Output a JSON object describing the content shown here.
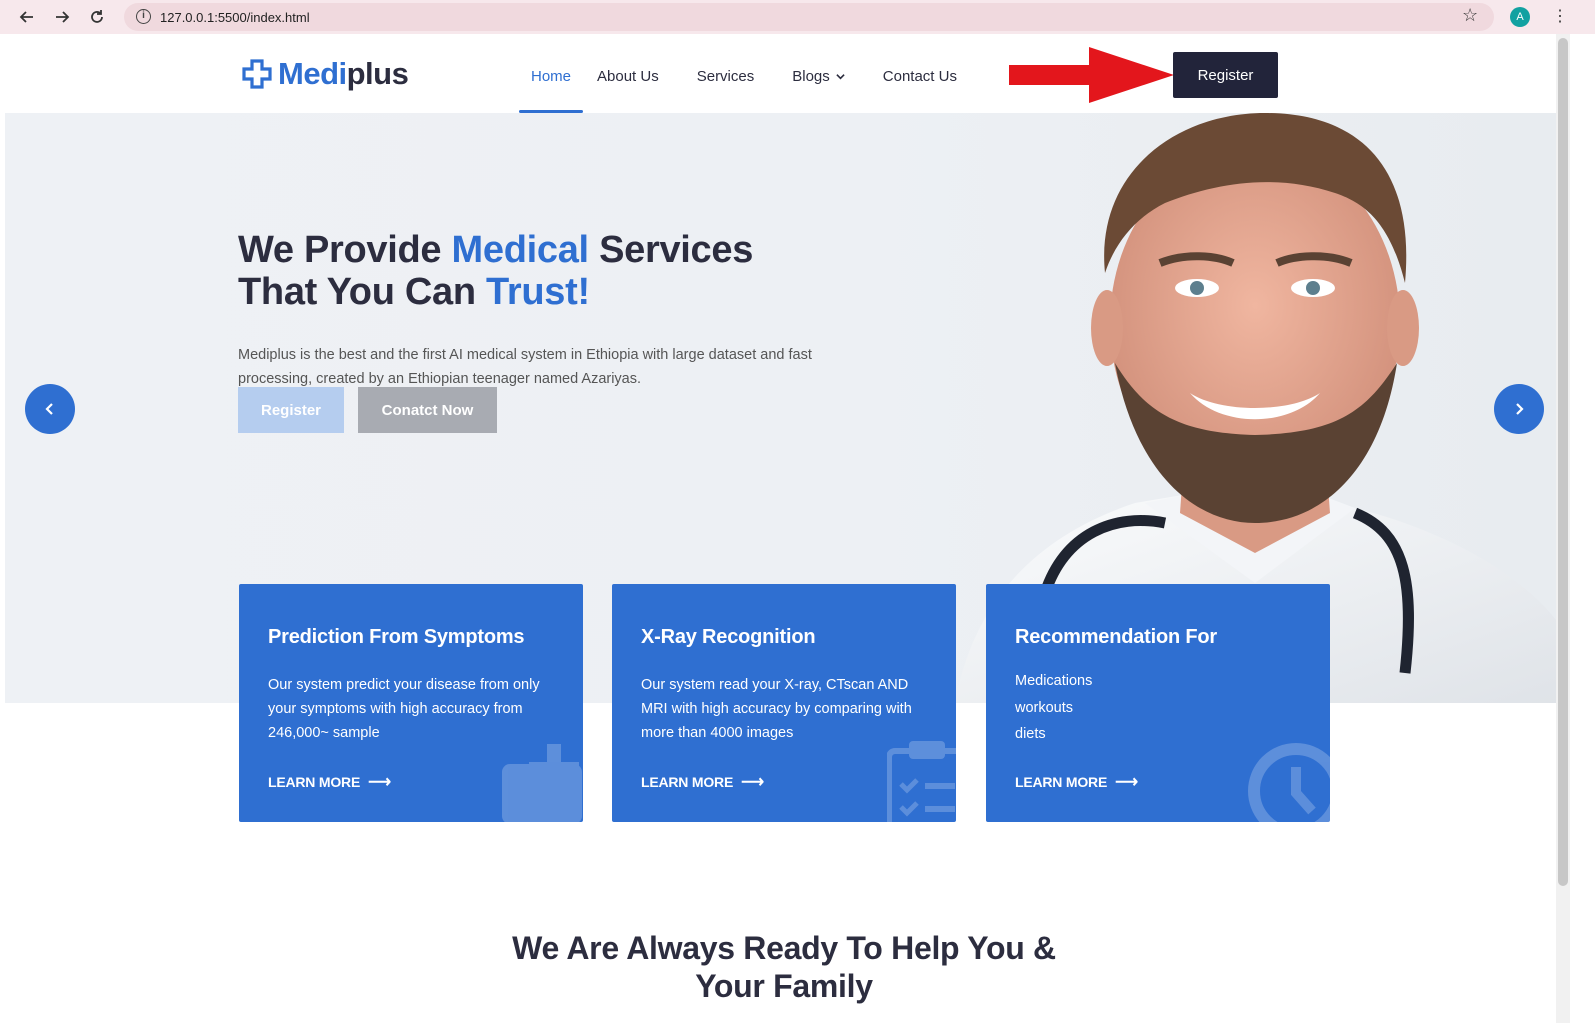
{
  "browser": {
    "url": "127.0.0.1:5500/index.html",
    "profile_initial": "A"
  },
  "header": {
    "logo_medi": "Medi",
    "logo_plus": "plus",
    "menu": [
      {
        "label": "Home",
        "active": true
      },
      {
        "label": "About Us"
      },
      {
        "label": "Services"
      },
      {
        "label": "Blogs"
      },
      {
        "label": "Contact Us"
      }
    ],
    "register_label": "Register"
  },
  "hero": {
    "title_1a": "We Provide ",
    "title_1b": "Medical",
    "title_1c": " Services",
    "title_2a": "That You Can ",
    "title_2b": "Trust!",
    "text": "Mediplus is the best and the first AI medical system in Ethiopia with large dataset and fast processing, created by an Ethiopian teenager named Azariyas.",
    "register_label": "Register",
    "contact_label": "Conatct Now"
  },
  "cards": [
    {
      "title": "Prediction From Symptoms",
      "text": "Our system predict your disease from only your symptoms with high accuracy from 246,000~ sample",
      "link": "LEARN MORE"
    },
    {
      "title": "X-Ray Recognition",
      "text": "Our system read your X-ray, CTscan AND MRI with high accuracy by comparing with more than 4000 images",
      "link": "LEARN MORE"
    },
    {
      "title": "Recommendation For",
      "items": [
        "Medications",
        "workouts",
        "diets"
      ],
      "link": "LEARN MORE"
    }
  ],
  "section": {
    "title_line1": "We Are Always Ready To Help You &",
    "title_line2": "Your Family"
  },
  "colors": {
    "primary": "#2f6fd1",
    "dark": "#2c2d3f",
    "register_dark": "#22243a",
    "annotation_arrow": "#e3161c"
  }
}
